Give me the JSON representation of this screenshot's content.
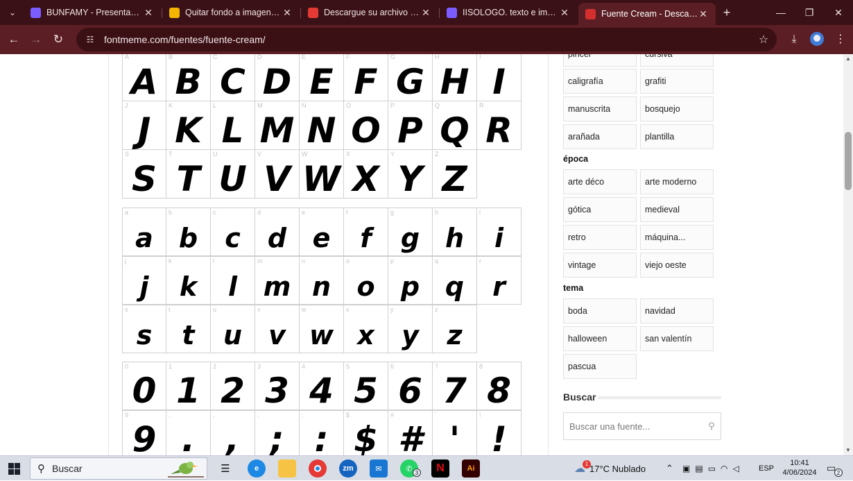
{
  "browser": {
    "tabs": [
      {
        "title": "BUNFAMY - Presentación",
        "icon": "canva-shield-icon",
        "color": "#7b5cff",
        "active": false
      },
      {
        "title": "Quitar fondo a imagenes online",
        "icon": "yellow-square-icon",
        "color": "#f5b400",
        "active": false
      },
      {
        "title": "Descargue su archivo — Con",
        "icon": "red-circle-icon",
        "color": "#e53935",
        "active": false
      },
      {
        "title": "IISOLOGO. texto e imagen/i",
        "icon": "canva-shield-icon",
        "color": "#7b5cff",
        "active": false
      },
      {
        "title": "Fuente Cream - Descargar",
        "icon": "fontmeme-f-icon",
        "color": "#d32f2f",
        "active": true
      }
    ],
    "url": "fontmeme.com/fuentes/fuente-cream/"
  },
  "glyphs": {
    "upper": [
      "A",
      "B",
      "C",
      "D",
      "E",
      "F",
      "G",
      "H",
      "I",
      "J",
      "K",
      "L",
      "M",
      "N",
      "O",
      "P",
      "Q",
      "R",
      "S",
      "T",
      "U",
      "V",
      "W",
      "X",
      "Y",
      "Z"
    ],
    "lower": [
      "a",
      "b",
      "c",
      "d",
      "e",
      "f",
      "g",
      "h",
      "i",
      "j",
      "k",
      "l",
      "m",
      "n",
      "o",
      "p",
      "q",
      "r",
      "s",
      "t",
      "u",
      "v",
      "w",
      "x",
      "y",
      "z"
    ],
    "digits": [
      "0",
      "1",
      "2",
      "3",
      "4",
      "5",
      "6",
      "7",
      "8",
      "9",
      ".",
      ",",
      ";",
      ":",
      "$",
      "#",
      "'",
      "!"
    ]
  },
  "sidebar": {
    "partial_tags": [
      "pincel",
      "cursiva"
    ],
    "style_tags": [
      "caligrafía",
      "grafiti",
      "manuscrita",
      "bosquejo",
      "arañada",
      "plantilla"
    ],
    "epoca_heading": "época",
    "epoca_tags": [
      "arte déco",
      "arte moderno",
      "gótica",
      "medieval",
      "retro",
      "máquina...",
      "vintage",
      "viejo oeste"
    ],
    "tema_heading": "tema",
    "tema_tags": [
      "boda",
      "navidad",
      "halloween",
      "san valentín",
      "pascua"
    ],
    "buscar_heading": "Buscar",
    "search_placeholder": "Buscar una fuente..."
  },
  "taskbar": {
    "search_label": "Buscar",
    "weather": "17°C  Nublado",
    "weather_badge": "1",
    "lang": "ESP",
    "time": "10:41",
    "date": "4/06/2024",
    "whatsapp_badge": "3",
    "notif_count": "2"
  }
}
